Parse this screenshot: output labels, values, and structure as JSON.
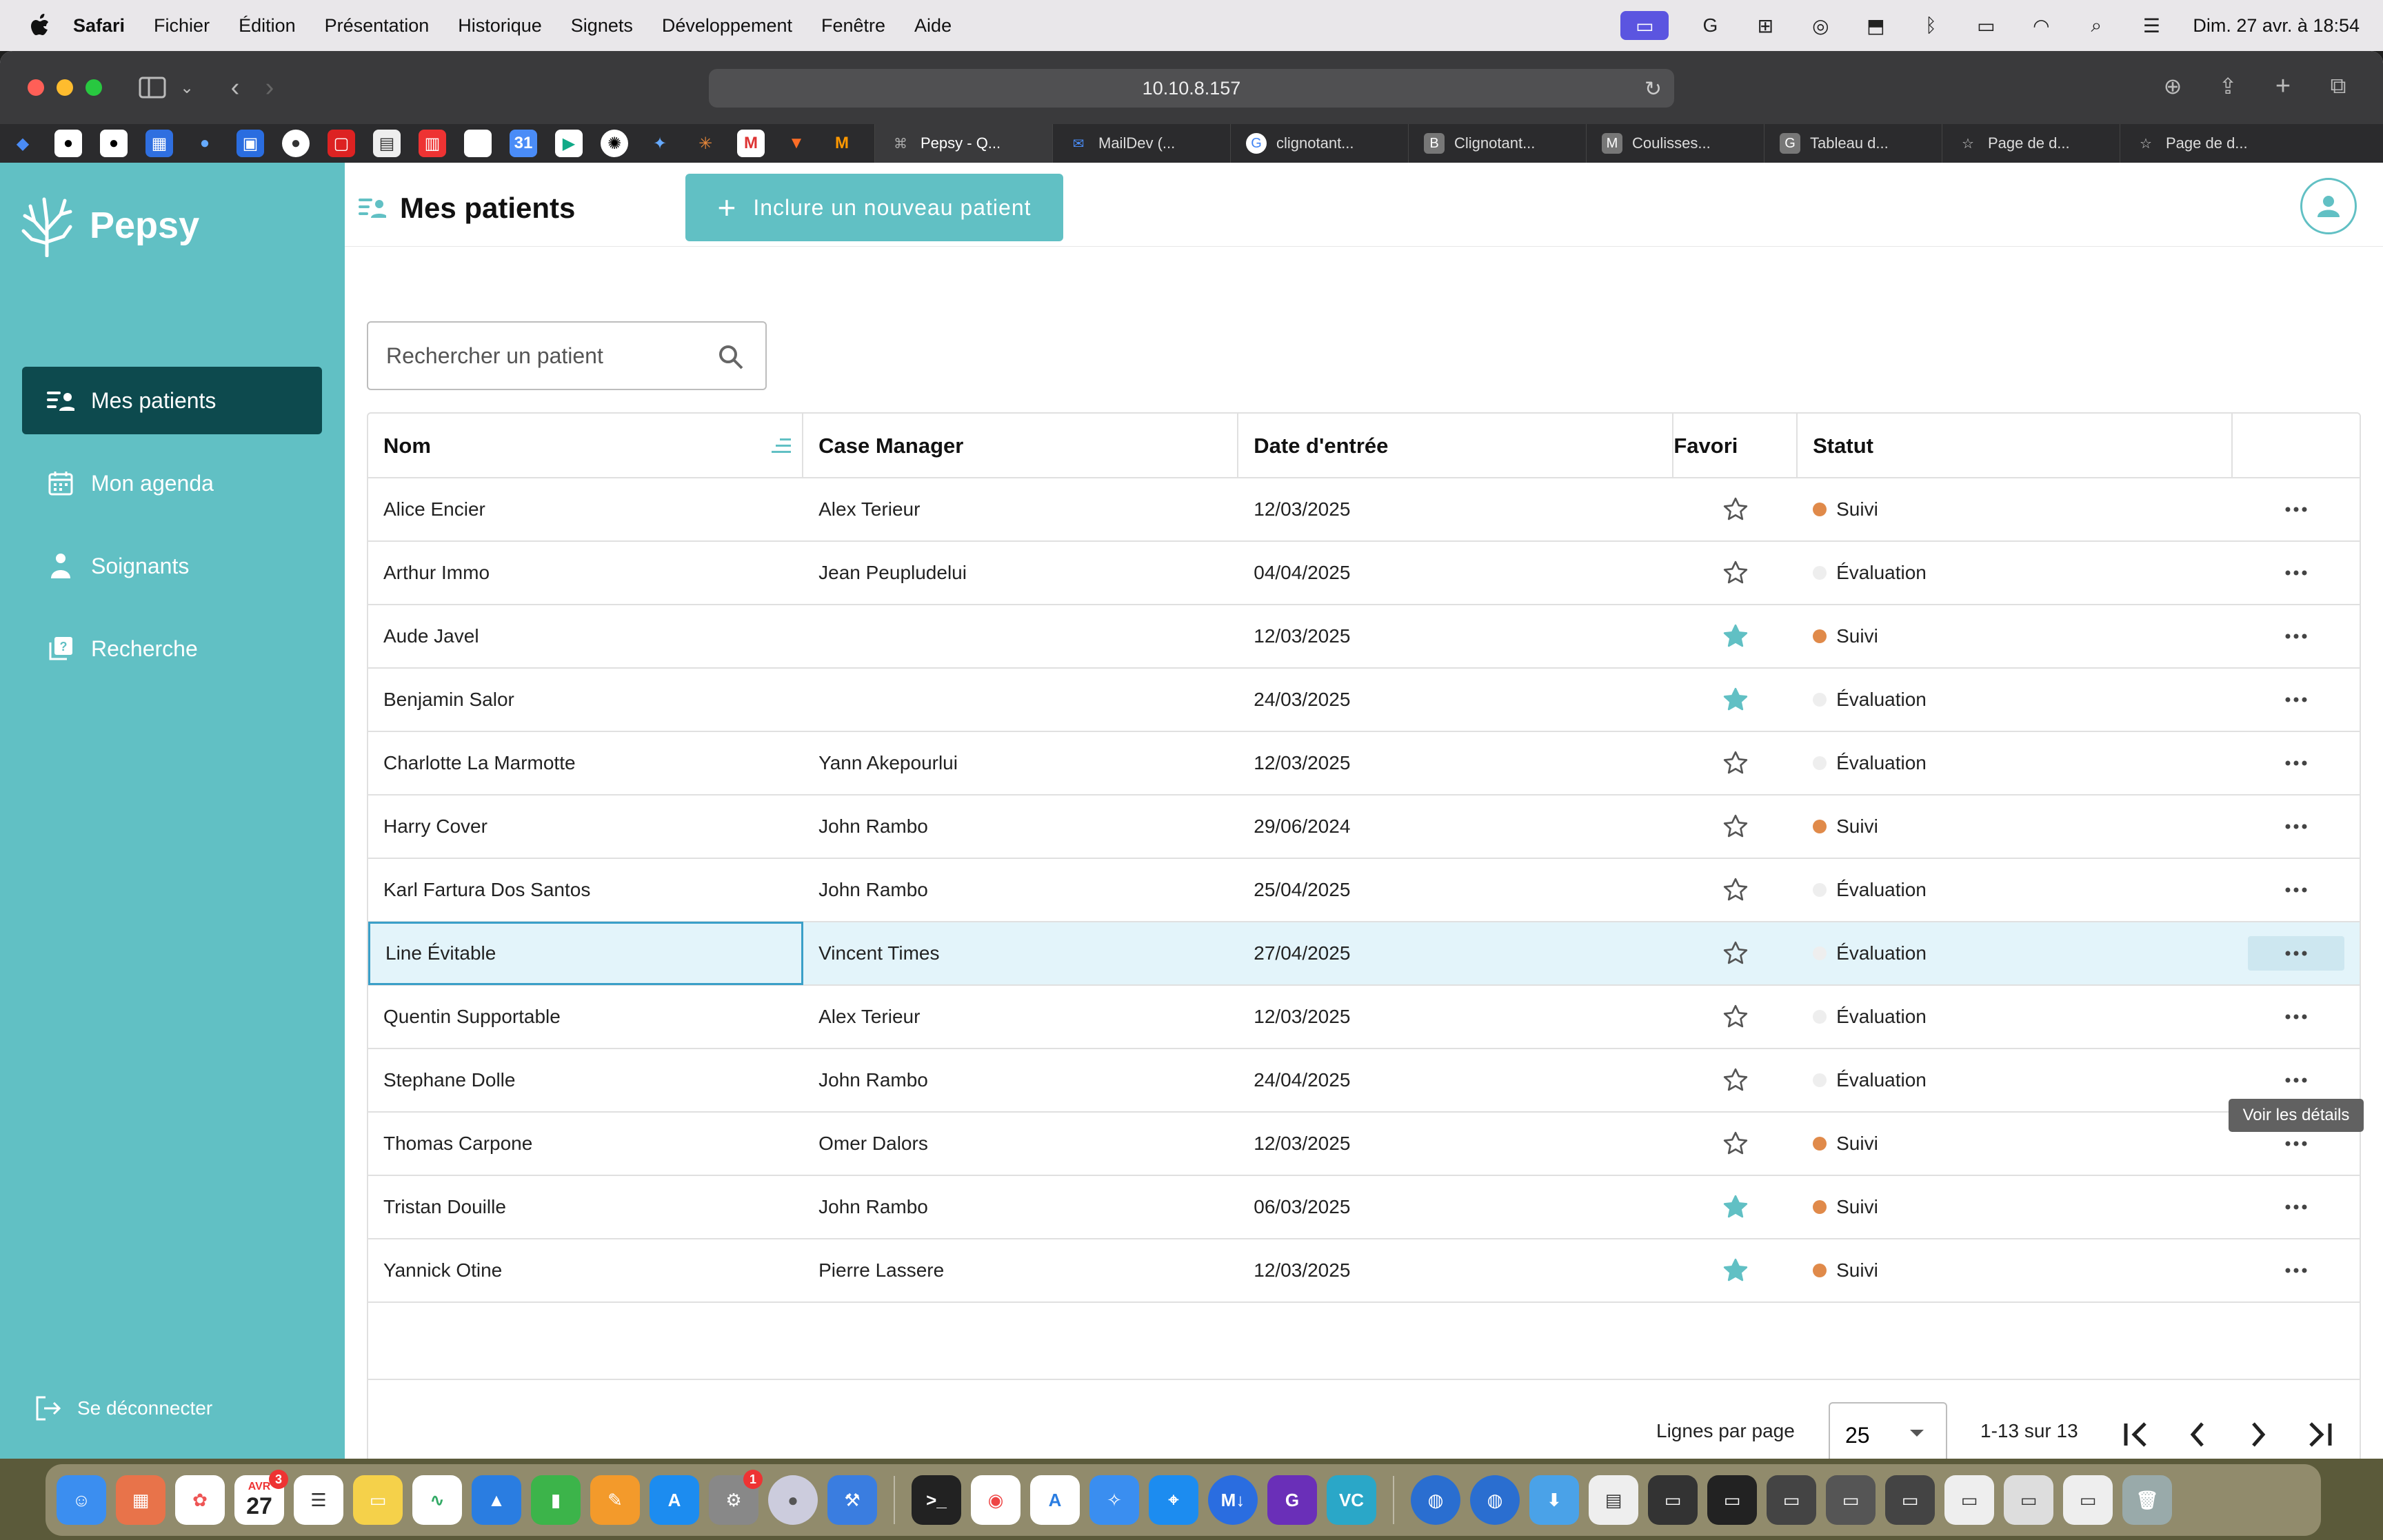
{
  "menubar": {
    "app_name": "Safari",
    "items": [
      "Fichier",
      "Édition",
      "Présentation",
      "Historique",
      "Signets",
      "Développement",
      "Fenêtre",
      "Aide"
    ],
    "clock": "Dim. 27 avr. à 18:54"
  },
  "browser": {
    "url": "10.10.8.157",
    "tabs": [
      {
        "label": "Pepsy - Q...",
        "active": true
      },
      {
        "label": "MailDev (..."
      },
      {
        "label": "clignotant..."
      },
      {
        "label": "Clignotant..."
      },
      {
        "label": "Coulisses..."
      },
      {
        "label": "Tableau d..."
      },
      {
        "label": "Page de d..."
      },
      {
        "label": "Page de d..."
      }
    ]
  },
  "app": {
    "brand": "Pepsy",
    "accent_color": "#61c0c4",
    "nav": [
      {
        "label": "Mes patients",
        "icon": "patients-list-icon",
        "active": true
      },
      {
        "label": "Mon agenda",
        "icon": "calendar-icon"
      },
      {
        "label": "Soignants",
        "icon": "caregiver-icon"
      },
      {
        "label": "Recherche",
        "icon": "research-icon"
      }
    ],
    "logout_label": "Se déconnecter"
  },
  "header": {
    "title": "Mes patients",
    "include_button": "Inclure un nouveau patient"
  },
  "search": {
    "placeholder": "Rechercher un patient"
  },
  "table": {
    "columns": [
      "Nom",
      "Case Manager",
      "Date d'entrée",
      "Favori",
      "Statut"
    ],
    "rows": [
      {
        "nom": "Alice Encier",
        "case_manager": "Alex Terieur",
        "date": "12/03/2025",
        "favori": false,
        "statut": "Suivi"
      },
      {
        "nom": "Arthur Immo",
        "case_manager": "Jean Peupludelui",
        "date": "04/04/2025",
        "favori": false,
        "statut": "Évaluation"
      },
      {
        "nom": "Aude Javel",
        "case_manager": "",
        "date": "12/03/2025",
        "favori": true,
        "statut": "Suivi"
      },
      {
        "nom": "Benjamin Salor",
        "case_manager": "",
        "date": "24/03/2025",
        "favori": true,
        "statut": "Évaluation"
      },
      {
        "nom": "Charlotte La Marmotte",
        "case_manager": "Yann Akepourlui",
        "date": "12/03/2025",
        "favori": false,
        "statut": "Évaluation"
      },
      {
        "nom": "Harry Cover",
        "case_manager": "John Rambo",
        "date": "29/06/2024",
        "favori": false,
        "statut": "Suivi"
      },
      {
        "nom": "Karl Fartura Dos Santos",
        "case_manager": "John Rambo",
        "date": "25/04/2025",
        "favori": false,
        "statut": "Évaluation"
      },
      {
        "nom": "Line Évitable",
        "case_manager": "Vincent Times",
        "date": "27/04/2025",
        "favori": false,
        "statut": "Évaluation",
        "selected": true
      },
      {
        "nom": "Quentin Supportable",
        "case_manager": "Alex Terieur",
        "date": "12/03/2025",
        "favori": false,
        "statut": "Évaluation"
      },
      {
        "nom": "Stephane Dolle",
        "case_manager": "John Rambo",
        "date": "24/04/2025",
        "favori": false,
        "statut": "Évaluation"
      },
      {
        "nom": "Thomas Carpone",
        "case_manager": "Omer Dalors",
        "date": "12/03/2025",
        "favori": false,
        "statut": "Suivi"
      },
      {
        "nom": "Tristan Douille",
        "case_manager": "John Rambo",
        "date": "06/03/2025",
        "favori": true,
        "statut": "Suivi"
      },
      {
        "nom": "Yannick Otine",
        "case_manager": "Pierre Lassere",
        "date": "12/03/2025",
        "favori": true,
        "statut": "Suivi"
      }
    ],
    "status_colors": {
      "Suivi": "#e08a4a",
      "Évaluation": "#eeeeee"
    },
    "tooltip": "Voir les détails"
  },
  "pagination": {
    "rows_label": "Lignes par page",
    "rows_per_page": "25",
    "range": "1-13 sur 13"
  },
  "dock": {
    "calendar_month": "AVR",
    "calendar_day": "27",
    "badge_calendar": "3",
    "badge_settings": "1"
  }
}
